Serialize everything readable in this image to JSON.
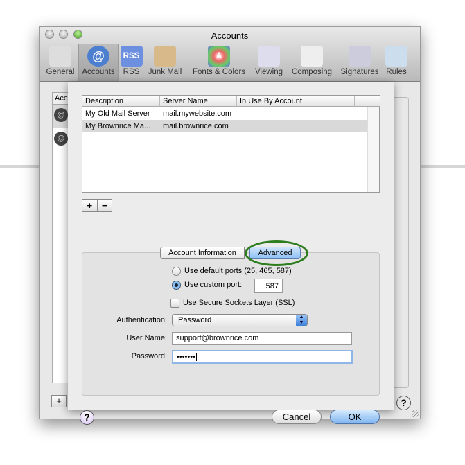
{
  "window": {
    "title": "Accounts"
  },
  "toolbar": [
    {
      "label": "General",
      "icon": "switch-icon"
    },
    {
      "label": "Accounts",
      "icon": "at-icon",
      "selected": true
    },
    {
      "label": "RSS",
      "icon": "rss-icon",
      "icon_text": "RSS"
    },
    {
      "label": "Junk Mail",
      "icon": "junk-mail-icon"
    },
    {
      "label": "Fonts & Colors",
      "icon": "fonts-colors-icon",
      "icon_text": "A"
    },
    {
      "label": "Viewing",
      "icon": "viewing-icon"
    },
    {
      "label": "Composing",
      "icon": "composing-icon"
    },
    {
      "label": "Signatures",
      "icon": "signatures-icon"
    },
    {
      "label": "Rules",
      "icon": "rules-icon"
    }
  ],
  "background": {
    "list_header": "Acc"
  },
  "sheet": {
    "columns": [
      "Description",
      "Server Name",
      "In Use By Account"
    ],
    "rows": [
      {
        "description": "My Old Mail Server",
        "server": "mail.mywebsite.com",
        "in_use": "",
        "selected": false
      },
      {
        "description": "My Brownrice Ma...",
        "server": "mail.brownrice.com",
        "in_use": "",
        "selected": true
      }
    ],
    "add_label": "+",
    "remove_label": "−",
    "tabs": [
      {
        "label": "Account Information",
        "active": false
      },
      {
        "label": "Advanced",
        "active": true
      }
    ],
    "ports": {
      "default_label": "Use default ports (25, 465, 587)",
      "custom_label": "Use custom port:",
      "selected": "custom",
      "custom_port": "587"
    },
    "ssl": {
      "label": "Use Secure Sockets Layer (SSL)",
      "checked": false
    },
    "authentication": {
      "label": "Authentication:",
      "value": "Password"
    },
    "username": {
      "label": "User Name:",
      "value": "support@brownrice.com"
    },
    "password": {
      "label": "Password:",
      "value": "•••••••"
    },
    "help": "?",
    "cancel": "Cancel",
    "ok": "OK"
  },
  "colors": {
    "highlight_ellipse": "#2e7d1e",
    "default_button": "#8ec0f5",
    "selected_row": "#d9d9d9"
  }
}
